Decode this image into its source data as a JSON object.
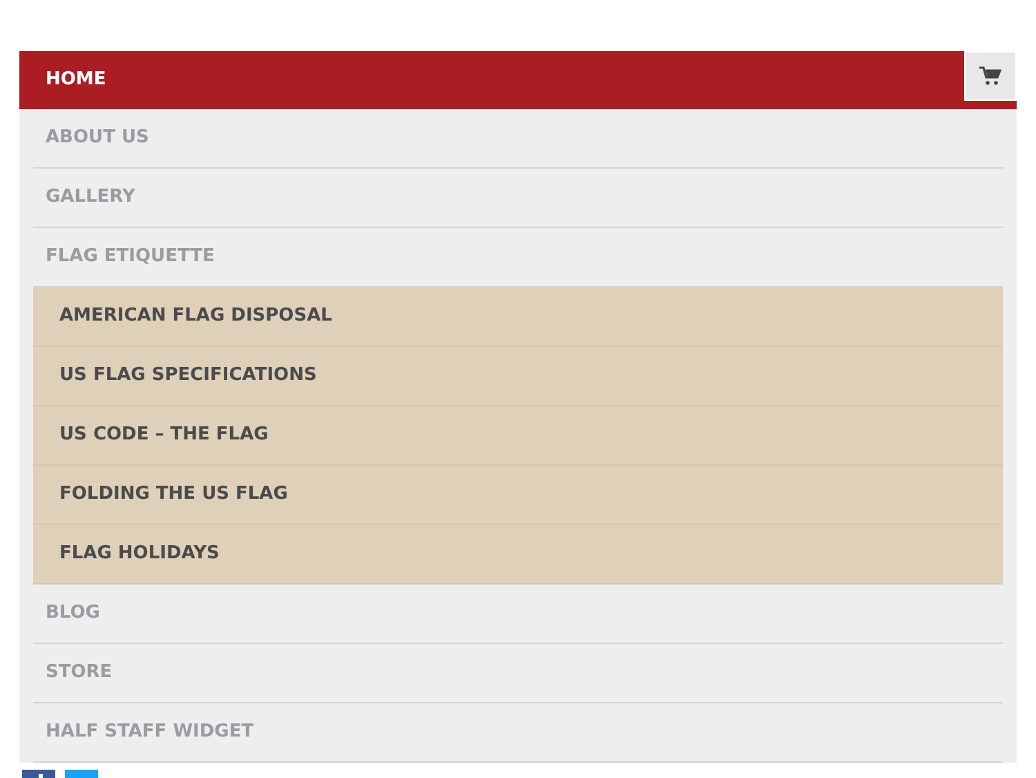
{
  "menu": [
    {
      "label": "HOME",
      "selected": true
    },
    {
      "label": "ABOUT US",
      "selected": false
    },
    {
      "label": "GALLERY",
      "selected": false
    },
    {
      "label": "FLAG ETIQUETTE",
      "selected": false,
      "expanded": true,
      "children": [
        {
          "label": "AMERICAN FLAG DISPOSAL",
          "selected": false
        },
        {
          "label": "US FLAG SPECIFICATIONS",
          "selected": false
        },
        {
          "label": "US CODE – THE FLAG",
          "selected": false
        },
        {
          "label": "FOLDING THE US FLAG",
          "selected": false
        },
        {
          "label": "FLAG HOLIDAYS",
          "selected": false
        }
      ]
    },
    {
      "label": "BLOG",
      "selected": false
    },
    {
      "label": "STORE",
      "selected": false
    },
    {
      "label": "HALF STAFF WIDGET",
      "selected": false
    }
  ]
}
